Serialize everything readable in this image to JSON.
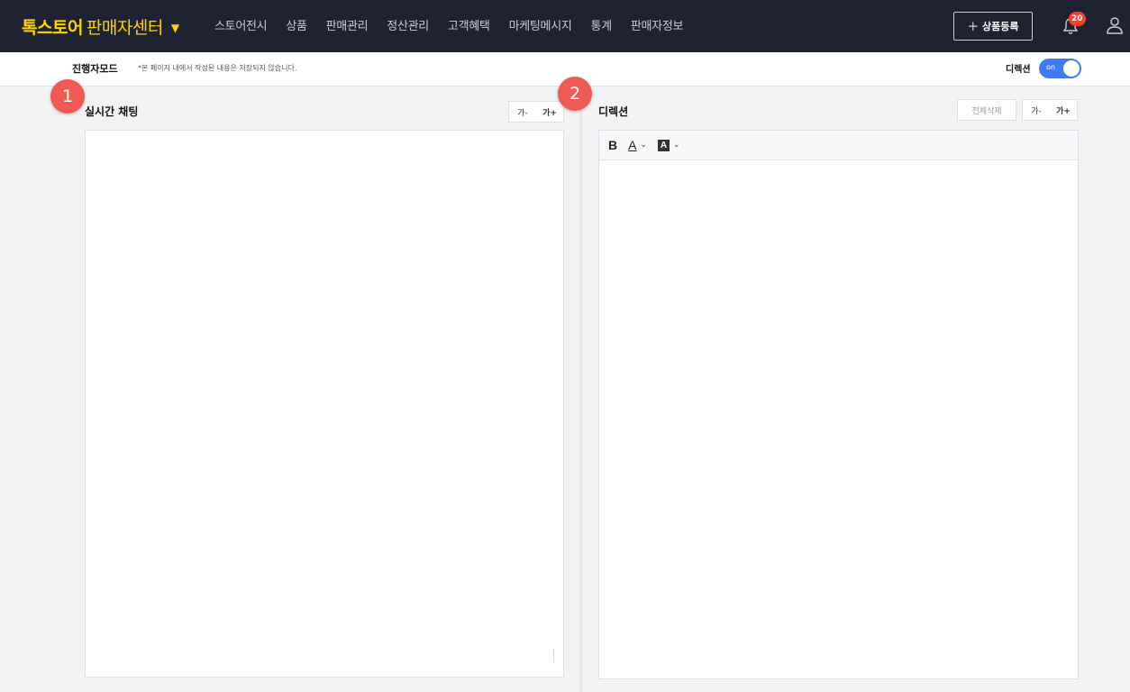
{
  "header": {
    "brand_primary": "톡스토어",
    "brand_secondary": "판매자센터",
    "nav": [
      "스토어전시",
      "상품",
      "판매관리",
      "정산관리",
      "고객혜택",
      "마케팅메시지",
      "통계",
      "판매자정보"
    ],
    "register_button": "상품등록",
    "notification_count": "20",
    "brand_color": "#ffd400"
  },
  "mode": {
    "title": "진행자모드",
    "note": "*본 페이지 내에서 작성된 내용은 저장되지 않습니다.",
    "direction_label": "디렉션",
    "toggle_label": "on",
    "toggle_color": "#3e7bf5"
  },
  "markers": [
    "1",
    "2"
  ],
  "chat_panel": {
    "title": "실시간 채팅",
    "font_decrease": "가-",
    "font_increase": "가+"
  },
  "direction_panel": {
    "title": "디렉션",
    "clear_button": "전체삭제",
    "font_decrease": "가-",
    "font_increase": "가+",
    "toolbar": {
      "bold": "B",
      "text_color": "A",
      "bg_color": "A"
    }
  }
}
